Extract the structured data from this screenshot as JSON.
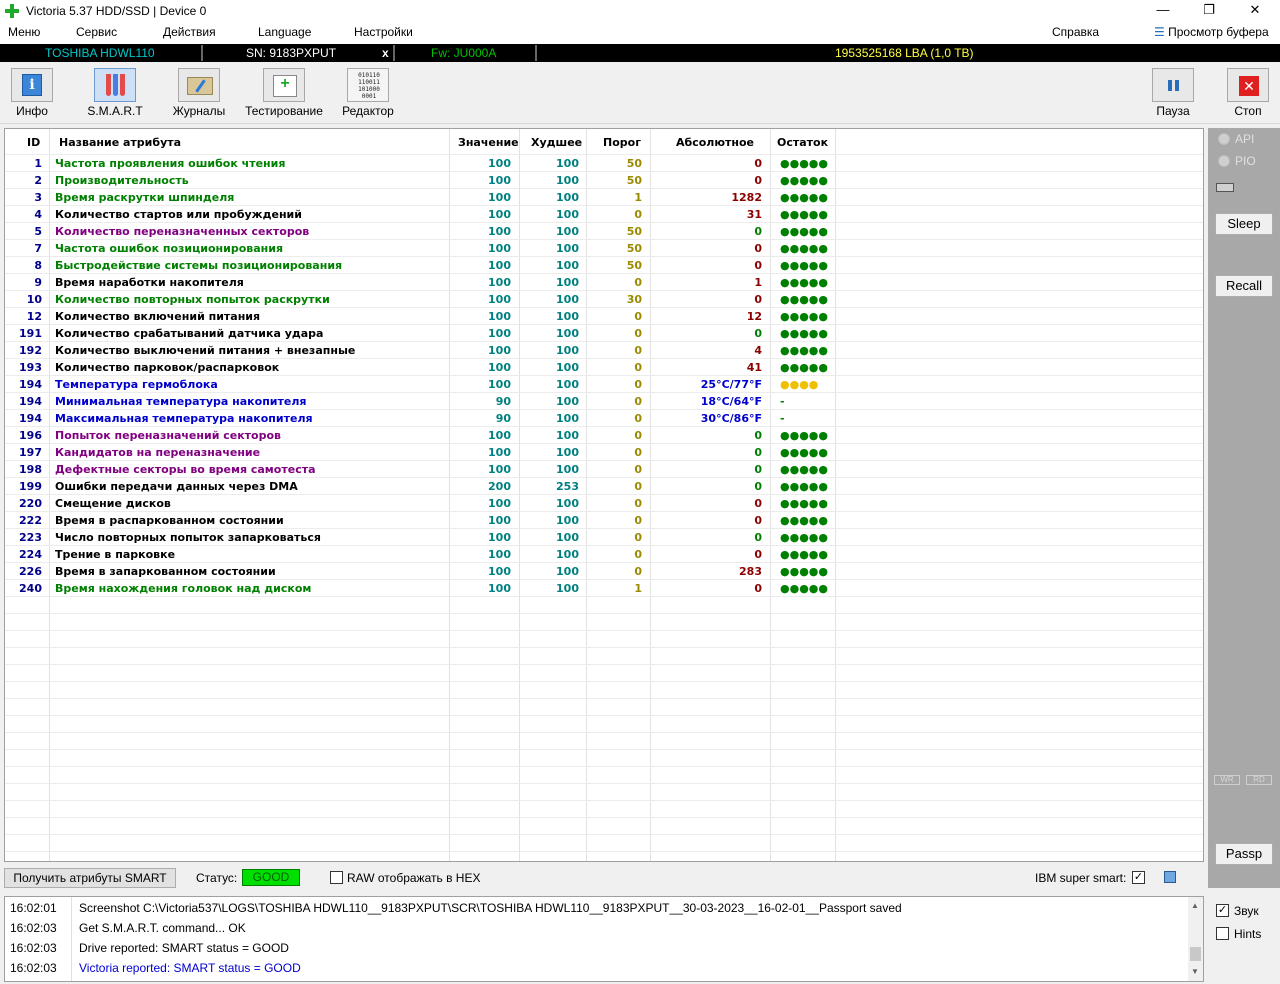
{
  "window": {
    "title": "Victoria 5.37 HDD/SSD | Device 0",
    "minimize": "—",
    "maximize": "❐",
    "close": "✕"
  },
  "menu": {
    "items": [
      "Меню",
      "Сервис",
      "Действия",
      "Language",
      "Настройки"
    ],
    "help": "Справка",
    "buffer": "Просмотр буфера"
  },
  "drive": {
    "model": "TOSHIBA HDWL110",
    "serial": "SN: 9183PXPUT",
    "close": "x",
    "firmware": "Fw: JU000A",
    "capacity": "1953525168 LBA (1,0 TB)"
  },
  "toolbar": {
    "info": "Инфо",
    "smart": "S.M.A.R.T",
    "journals": "Журналы",
    "testing": "Тестирование",
    "editor": "Редактор",
    "pause": "Пауза",
    "stop": "Стоп",
    "editor_icon_text": "010110 110011 101000 0001"
  },
  "table": {
    "headers": {
      "id": "ID",
      "name": "Название атрибута",
      "value": "Значение",
      "worst": "Худшее",
      "threshold": "Порог",
      "absolute": "Абсолютное",
      "remaining": "Остаток"
    },
    "rows": [
      {
        "id": "1",
        "name": "Частота проявления ошибок чтения",
        "value": "100",
        "worst": "100",
        "threshold": "50",
        "absolute": "0",
        "remaining": "●●●●●",
        "name_color": "#008000",
        "abs_color": "#8b0000",
        "rem_color": "#008000"
      },
      {
        "id": "2",
        "name": "Производительность",
        "value": "100",
        "worst": "100",
        "threshold": "50",
        "absolute": "0",
        "remaining": "●●●●●",
        "name_color": "#008000",
        "abs_color": "#8b0000",
        "rem_color": "#008000"
      },
      {
        "id": "3",
        "name": "Время раскрутки шпинделя",
        "value": "100",
        "worst": "100",
        "threshold": "1",
        "absolute": "1282",
        "remaining": "●●●●●",
        "name_color": "#008000",
        "abs_color": "#8b0000",
        "rem_color": "#008000"
      },
      {
        "id": "4",
        "name": "Количество стартов или пробуждений",
        "value": "100",
        "worst": "100",
        "threshold": "0",
        "absolute": "31",
        "remaining": "●●●●●",
        "name_color": "#000000",
        "abs_color": "#8b0000",
        "rem_color": "#008000"
      },
      {
        "id": "5",
        "name": "Количество переназначенных секторов",
        "value": "100",
        "worst": "100",
        "threshold": "50",
        "absolute": "0",
        "remaining": "●●●●●",
        "name_color": "#800080",
        "abs_color": "#008000",
        "rem_color": "#008000"
      },
      {
        "id": "7",
        "name": "Частота ошибок позиционирования",
        "value": "100",
        "worst": "100",
        "threshold": "50",
        "absolute": "0",
        "remaining": "●●●●●",
        "name_color": "#008000",
        "abs_color": "#8b0000",
        "rem_color": "#008000"
      },
      {
        "id": "8",
        "name": "Быстродействие системы позиционирования",
        "value": "100",
        "worst": "100",
        "threshold": "50",
        "absolute": "0",
        "remaining": "●●●●●",
        "name_color": "#008000",
        "abs_color": "#8b0000",
        "rem_color": "#008000"
      },
      {
        "id": "9",
        "name": "Время наработки накопителя",
        "value": "100",
        "worst": "100",
        "threshold": "0",
        "absolute": "1",
        "remaining": "●●●●●",
        "name_color": "#000000",
        "abs_color": "#8b0000",
        "rem_color": "#008000"
      },
      {
        "id": "10",
        "name": "Количество повторных попыток раскрутки",
        "value": "100",
        "worst": "100",
        "threshold": "30",
        "absolute": "0",
        "remaining": "●●●●●",
        "name_color": "#008000",
        "abs_color": "#8b0000",
        "rem_color": "#008000"
      },
      {
        "id": "12",
        "name": "Количество включений питания",
        "value": "100",
        "worst": "100",
        "threshold": "0",
        "absolute": "12",
        "remaining": "●●●●●",
        "name_color": "#000000",
        "abs_color": "#8b0000",
        "rem_color": "#008000"
      },
      {
        "id": "191",
        "name": "Количество срабатываний датчика удара",
        "value": "100",
        "worst": "100",
        "threshold": "0",
        "absolute": "0",
        "remaining": "●●●●●",
        "name_color": "#000000",
        "abs_color": "#008000",
        "rem_color": "#008000"
      },
      {
        "id": "192",
        "name": "Количество выключений питания + внезапные",
        "value": "100",
        "worst": "100",
        "threshold": "0",
        "absolute": "4",
        "remaining": "●●●●●",
        "name_color": "#000000",
        "abs_color": "#8b0000",
        "rem_color": "#008000"
      },
      {
        "id": "193",
        "name": "Количество парковок/распарковок",
        "value": "100",
        "worst": "100",
        "threshold": "0",
        "absolute": "41",
        "remaining": "●●●●●",
        "name_color": "#000000",
        "abs_color": "#8b0000",
        "rem_color": "#008000"
      },
      {
        "id": "194",
        "name": "Температура гермоблока",
        "value": "100",
        "worst": "100",
        "threshold": "0",
        "absolute": "25°C/77°F",
        "remaining": "●●●●",
        "name_color": "#0000cd",
        "abs_color": "#0000cd",
        "rem_color": "#f0c000"
      },
      {
        "id": "194",
        "name": "Минимальная температура накопителя",
        "value": "90",
        "worst": "100",
        "threshold": "0",
        "absolute": "18°C/64°F",
        "remaining": "-",
        "name_color": "#0000cd",
        "abs_color": "#0000cd",
        "rem_color": "#008000"
      },
      {
        "id": "194",
        "name": "Максимальная температура накопителя",
        "value": "90",
        "worst": "100",
        "threshold": "0",
        "absolute": "30°C/86°F",
        "remaining": "-",
        "name_color": "#0000cd",
        "abs_color": "#0000cd",
        "rem_color": "#008000"
      },
      {
        "id": "196",
        "name": "Попыток переназначений секторов",
        "value": "100",
        "worst": "100",
        "threshold": "0",
        "absolute": "0",
        "remaining": "●●●●●",
        "name_color": "#800080",
        "abs_color": "#008000",
        "rem_color": "#008000"
      },
      {
        "id": "197",
        "name": "Кандидатов на переназначение",
        "value": "100",
        "worst": "100",
        "threshold": "0",
        "absolute": "0",
        "remaining": "●●●●●",
        "name_color": "#800080",
        "abs_color": "#008000",
        "rem_color": "#008000"
      },
      {
        "id": "198",
        "name": "Дефектные секторы во время самотеста",
        "value": "100",
        "worst": "100",
        "threshold": "0",
        "absolute": "0",
        "remaining": "●●●●●",
        "name_color": "#800080",
        "abs_color": "#008000",
        "rem_color": "#008000"
      },
      {
        "id": "199",
        "name": "Ошибки передачи данных через DMA",
        "value": "200",
        "worst": "253",
        "threshold": "0",
        "absolute": "0",
        "remaining": "●●●●●",
        "name_color": "#000000",
        "abs_color": "#008000",
        "rem_color": "#008000"
      },
      {
        "id": "220",
        "name": "Смещение дисков",
        "value": "100",
        "worst": "100",
        "threshold": "0",
        "absolute": "0",
        "remaining": "●●●●●",
        "name_color": "#000000",
        "abs_color": "#8b0000",
        "rem_color": "#008000"
      },
      {
        "id": "222",
        "name": "Время в распаркованном состоянии",
        "value": "100",
        "worst": "100",
        "threshold": "0",
        "absolute": "0",
        "remaining": "●●●●●",
        "name_color": "#000000",
        "abs_color": "#8b0000",
        "rem_color": "#008000"
      },
      {
        "id": "223",
        "name": "Число повторных попыток запарковаться",
        "value": "100",
        "worst": "100",
        "threshold": "0",
        "absolute": "0",
        "remaining": "●●●●●",
        "name_color": "#000000",
        "abs_color": "#008000",
        "rem_color": "#008000"
      },
      {
        "id": "224",
        "name": "Трение в парковке",
        "value": "100",
        "worst": "100",
        "threshold": "0",
        "absolute": "0",
        "remaining": "●●●●●",
        "name_color": "#000000",
        "abs_color": "#8b0000",
        "rem_color": "#008000"
      },
      {
        "id": "226",
        "name": "Время в запаркованном состоянии",
        "value": "100",
        "worst": "100",
        "threshold": "0",
        "absolute": "283",
        "remaining": "●●●●●",
        "name_color": "#000000",
        "abs_color": "#8b0000",
        "rem_color": "#008000"
      },
      {
        "id": "240",
        "name": "Время нахождения головок над диском",
        "value": "100",
        "worst": "100",
        "threshold": "1",
        "absolute": "0",
        "remaining": "●●●●●",
        "name_color": "#008000",
        "abs_color": "#8b0000",
        "rem_color": "#008000"
      }
    ]
  },
  "right_panel": {
    "api": "API",
    "pio": "PIO",
    "sleep": "Sleep",
    "recall": "Recall",
    "wr": "WR",
    "rd": "RD",
    "passp": "Passp"
  },
  "status_bar": {
    "get_smart": "Получить атрибуты SMART",
    "status_label": "Статус:",
    "status_value": "GOOD",
    "raw_hex": "RAW отображать в HEX",
    "ibm_super_smart": "IBM super smart:"
  },
  "log": [
    {
      "time": "16:02:01",
      "msg": "Screenshot C:\\Victoria537\\LOGS\\TOSHIBA HDWL110__9183PXPUT\\SCR\\TOSHIBA HDWL110__9183PXPUT__30-03-2023__16-02-01__Passport saved",
      "color": "#000000"
    },
    {
      "time": "16:02:03",
      "msg": "Get S.M.A.R.T. command... OK",
      "color": "#000000"
    },
    {
      "time": "16:02:03",
      "msg": "Drive reported: SMART status = GOOD",
      "color": "#000000"
    },
    {
      "time": "16:02:03",
      "msg": "Victoria reported: SMART status = GOOD",
      "color": "#0000cd"
    }
  ],
  "options": {
    "sound": "Звук",
    "sound_checked": true,
    "hints": "Hints",
    "hints_checked": false
  }
}
